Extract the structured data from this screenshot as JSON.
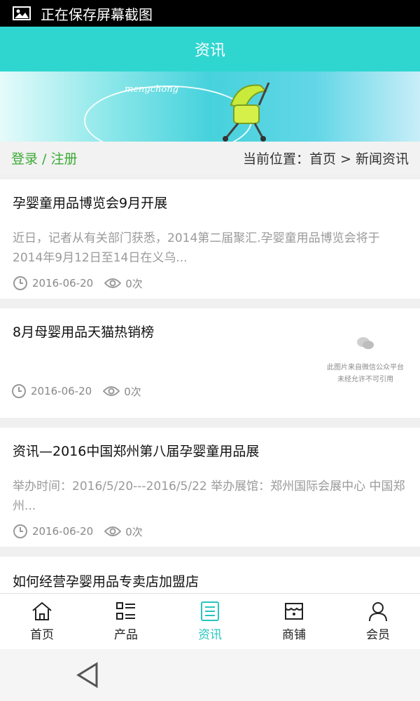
{
  "statusbar": {
    "text": "正在保存屏幕截图",
    "icon": "image-icon"
  },
  "header": {
    "title": "资讯"
  },
  "banner": {
    "script_text": "mengchong"
  },
  "breadcrumb": {
    "login": "登录 / 注册",
    "location": "当前位置：首页 > 新闻资讯"
  },
  "articles": [
    {
      "title": "孕婴童用品博览会9月开展",
      "desc": "近日，记者从有关部门获悉，2014第二届聚汇.孕婴童用品博览会将于2014年9月12日至14日在义乌...",
      "date": "2016-06-20",
      "views": "0次"
    },
    {
      "title": "8月母婴用品天猫热销榜",
      "date": "2016-06-20",
      "views": "0次",
      "watermark_line1": "此图片来自微信公众平台",
      "watermark_line2": "未经允许不可引用"
    },
    {
      "title": "资讯—2016中国郑州第八届孕婴童用品展",
      "desc": "举办时间：2016/5/20---2016/5/22 举办展馆：郑州国际会展中心 中国郑州...",
      "date": "2016-06-20",
      "views": "0次"
    },
    {
      "title": "如何经营孕婴用品专卖店加盟店"
    }
  ],
  "tabs": [
    {
      "label": "首页",
      "icon": "home-icon"
    },
    {
      "label": "产品",
      "icon": "list-icon"
    },
    {
      "label": "资讯",
      "icon": "news-icon",
      "active": true
    },
    {
      "label": "商铺",
      "icon": "shop-icon"
    },
    {
      "label": "会员",
      "icon": "user-icon"
    }
  ],
  "colors": {
    "accent": "#2fd6d0",
    "login_green": "#3aaa35",
    "active_tab": "#26c6c0"
  }
}
